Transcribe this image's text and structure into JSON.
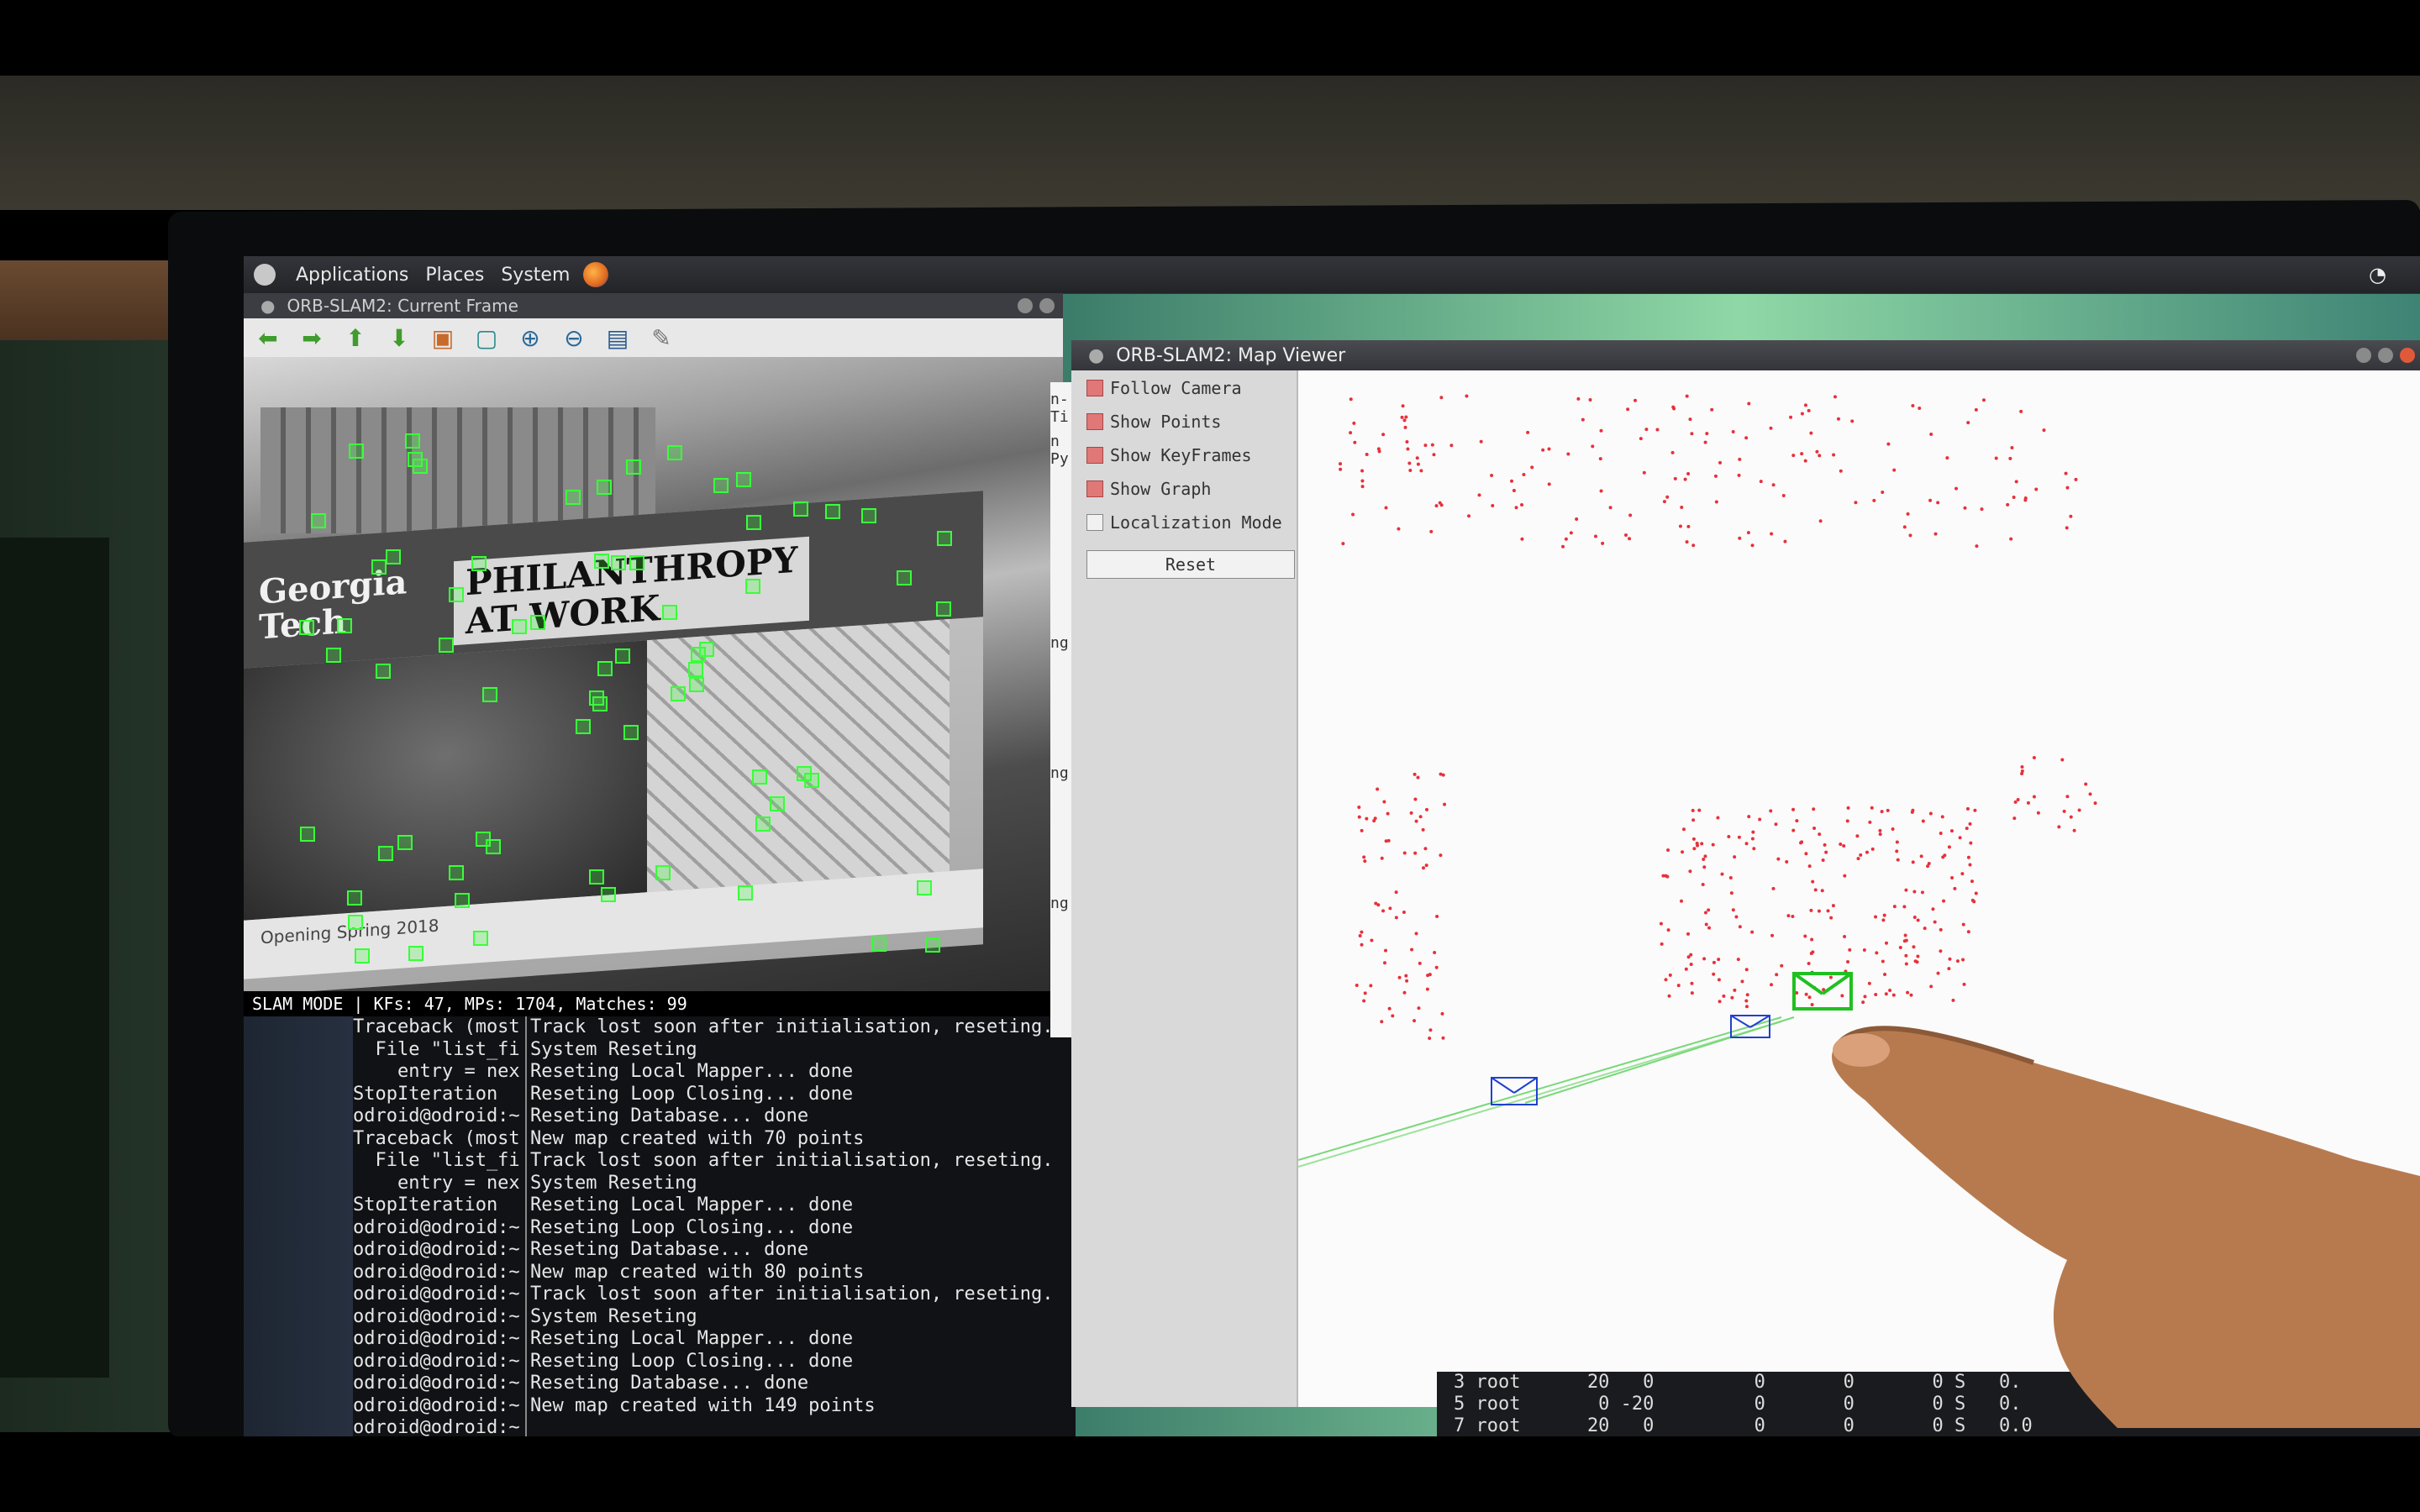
{
  "desktop": {
    "menus": [
      "Applications",
      "Places",
      "System"
    ]
  },
  "frame_window": {
    "title": "ORB-SLAM2: Current Frame",
    "banner_logo": "Georgia Tech",
    "banner_headline_1": "PHILANTHROPY",
    "banner_headline_2": "AT WORK",
    "banner_footer": "Opening Spring 2018",
    "status": "SLAM MODE |  KFs: 47, MPs: 1704, Matches: 99"
  },
  "terminal": {
    "left_lines": [
      "Traceback (most",
      "  File \"list_fi",
      "    entry = nex",
      "StopIteration",
      "odroid@odroid:~",
      "Traceback (most",
      "  File \"list_fi",
      "    entry = nex",
      "StopIteration",
      "odroid@odroid:~",
      "odroid@odroid:~",
      "odroid@odroid:~",
      "odroid@odroid:~",
      "odroid@odroid:~",
      "odroid@odroid:~",
      "odroid@odroid:~",
      "odroid@odroid:~",
      "odroid@odroid:~",
      "odroid@odroid:~"
    ],
    "right_lines": [
      "Track lost soon after initialisation, reseting.",
      "System Reseting",
      "Reseting Local Mapper... done",
      "Reseting Loop Closing... done",
      "Reseting Database... done",
      "New map created with 70 points",
      "Track lost soon after initialisation, reseting.",
      "System Reseting",
      "Reseting Local Mapper... done",
      "Reseting Loop Closing... done",
      "Reseting Database... done",
      "New map created with 80 points",
      "Track lost soon after initialisation, reseting.",
      "System Reseting",
      "Reseting Local Mapper... done",
      "Reseting Loop Closing... done",
      "Reseting Database... done",
      "New map created with 149 points"
    ],
    "side_fragments": [
      "n-Ti",
      "n Py",
      "ng.",
      "ng.",
      "ng."
    ]
  },
  "map_viewer": {
    "title": "ORB-SLAM2: Map Viewer",
    "options": [
      {
        "label": "Follow Camera",
        "checked": true
      },
      {
        "label": "Show Points",
        "checked": true
      },
      {
        "label": "Show KeyFrames",
        "checked": true
      },
      {
        "label": "Show Graph",
        "checked": true
      },
      {
        "label": "Localization Mode",
        "checked": false
      }
    ],
    "reset_label": "Reset",
    "point_color": "#e8303a",
    "keyframe_color": "#2040d0",
    "current_camera_color": "#20c020"
  },
  "process_list": [
    "3 root      20   0         0       0       0 S   0.",
    "5 root       0 -20         0       0       0 S   0.",
    "7 root      20   0         0       0       0 S   0.0"
  ],
  "colors": {
    "feature": "#39ff39",
    "terminal_bg": "#111216"
  }
}
